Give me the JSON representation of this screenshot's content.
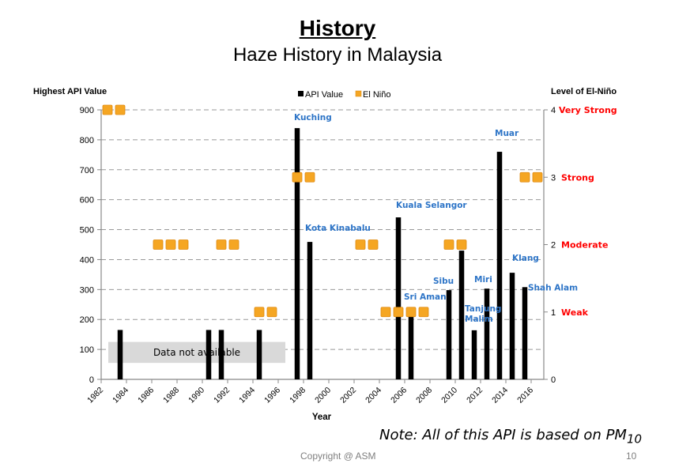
{
  "slide": {
    "title": "History",
    "subtitle": "Haze History in Malaysia",
    "note_prefix": "Note: All of this API is based on PM",
    "note_subscript": "10",
    "copyright": "Copyright @ ASM",
    "page_number": "10"
  },
  "chart_data": {
    "type": "bar",
    "title": "Haze History in Malaysia",
    "xlabel": "Year",
    "ylabel": "Highest API Value",
    "y2label": "Level of El-Niño",
    "ylim": [
      0,
      900
    ],
    "y2lim": [
      0,
      4
    ],
    "yticks": [
      0,
      100,
      200,
      300,
      400,
      500,
      600,
      700,
      800,
      900
    ],
    "y2ticks": [
      {
        "value": 0,
        "label": "0",
        "name": ""
      },
      {
        "value": 1,
        "label": "1",
        "name": "Weak"
      },
      {
        "value": 2,
        "label": "2",
        "name": "Moderate"
      },
      {
        "value": 3,
        "label": "3",
        "name": "Strong"
      },
      {
        "value": 4,
        "label": "4",
        "name": "Very Strong"
      }
    ],
    "grid": true,
    "legend": {
      "position": "top-center",
      "entries": [
        "API Value",
        "El Niño"
      ]
    },
    "x_range": [
      1982,
      2016
    ],
    "xtick_labels": [
      "1982",
      "1984",
      "1986",
      "1988",
      "1990",
      "1992",
      "1994",
      "1996",
      "1998",
      "2000",
      "2002",
      "2004",
      "2006",
      "2008",
      "2010",
      "2012",
      "2014",
      "2016"
    ],
    "series": [
      {
        "name": "API Value",
        "type": "bar",
        "color": "#000000",
        "points": [
          {
            "year": 1983,
            "value": 165,
            "label": ""
          },
          {
            "year": 1990,
            "value": 165,
            "label": ""
          },
          {
            "year": 1991,
            "value": 165,
            "label": ""
          },
          {
            "year": 1994,
            "value": 165,
            "label": ""
          },
          {
            "year": 1997,
            "value": 839,
            "label": "Kuching"
          },
          {
            "year": 1998,
            "value": 459,
            "label": "Kota Kinabalu"
          },
          {
            "year": 2005,
            "value": 541,
            "label": "Kuala Selangor"
          },
          {
            "year": 2006,
            "value": 209,
            "label": "Sri Aman"
          },
          {
            "year": 2009,
            "value": 298,
            "label": "Sibu"
          },
          {
            "year": 2010,
            "value": 430,
            "label": ""
          },
          {
            "year": 2011,
            "value": 164,
            "label": "Tanjung Malim"
          },
          {
            "year": 2012,
            "value": 303,
            "label": "Miri"
          },
          {
            "year": 2013,
            "value": 760,
            "label": "Muar"
          },
          {
            "year": 2014,
            "value": 356,
            "label": "Klang"
          },
          {
            "year": 2015,
            "value": 308,
            "label": "Shah Alam"
          }
        ]
      },
      {
        "name": "El Niño",
        "type": "marker",
        "axis": "right",
        "color": "#f5a623",
        "points": [
          {
            "year": 1982,
            "level": 4
          },
          {
            "year": 1983,
            "level": 4
          },
          {
            "year": 1986,
            "level": 2
          },
          {
            "year": 1987,
            "level": 2
          },
          {
            "year": 1988,
            "level": 2
          },
          {
            "year": 1991,
            "level": 2
          },
          {
            "year": 1992,
            "level": 2
          },
          {
            "year": 1994,
            "level": 1
          },
          {
            "year": 1995,
            "level": 1
          },
          {
            "year": 1997,
            "level": 3
          },
          {
            "year": 1998,
            "level": 3
          },
          {
            "year": 2002,
            "level": 2
          },
          {
            "year": 2003,
            "level": 2
          },
          {
            "year": 2004,
            "level": 1
          },
          {
            "year": 2005,
            "level": 1
          },
          {
            "year": 2006,
            "level": 1
          },
          {
            "year": 2007,
            "level": 1
          },
          {
            "year": 2009,
            "level": 2
          },
          {
            "year": 2010,
            "level": 2
          },
          {
            "year": 2015,
            "level": 3
          },
          {
            "year": 2016,
            "level": 3
          }
        ]
      }
    ],
    "annotations": [
      {
        "text": "Data not available",
        "x_range": [
          1982.5,
          1996.5
        ],
        "y_range": [
          55,
          125
        ]
      }
    ],
    "colors": {
      "label_blue": "#2e75c7",
      "level_red": "#ff0000",
      "grid": "#999999",
      "na_box": "#d9d9d9"
    }
  }
}
